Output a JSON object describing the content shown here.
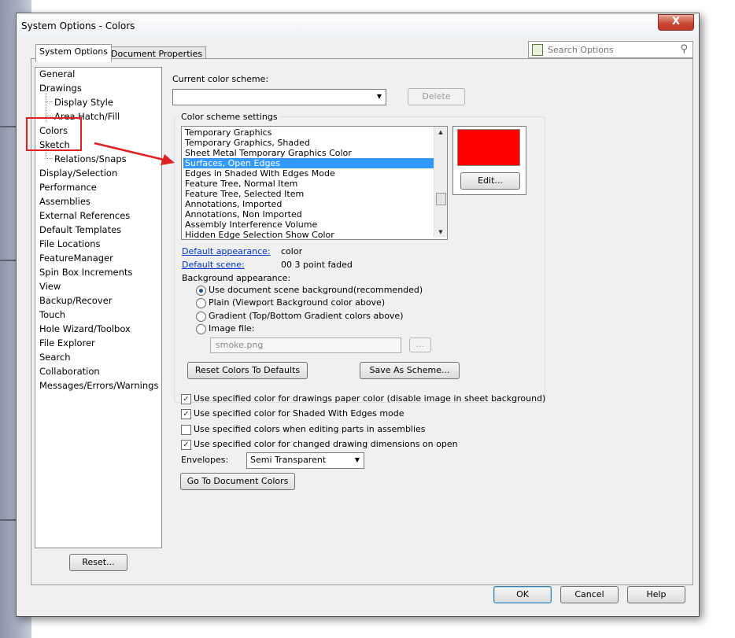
{
  "window": {
    "title": "System Options - Colors",
    "close_glyph": "X"
  },
  "tabs": [
    {
      "label": "System Options",
      "active": true
    },
    {
      "label": "Document Properties",
      "active": false
    }
  ],
  "search": {
    "placeholder": "Search Options",
    "value": ""
  },
  "tree": {
    "items": [
      {
        "label": "General",
        "level": 0
      },
      {
        "label": "Drawings",
        "level": 0
      },
      {
        "label": "Display Style",
        "level": 1
      },
      {
        "label": "Area Hatch/Fill",
        "level": 1
      },
      {
        "label": "Colors",
        "level": 0
      },
      {
        "label": "Sketch",
        "level": 0
      },
      {
        "label": "Relations/Snaps",
        "level": 1
      },
      {
        "label": "Display/Selection",
        "level": 0
      },
      {
        "label": "Performance",
        "level": 0
      },
      {
        "label": "Assemblies",
        "level": 0
      },
      {
        "label": "External References",
        "level": 0
      },
      {
        "label": "Default Templates",
        "level": 0
      },
      {
        "label": "File Locations",
        "level": 0
      },
      {
        "label": "FeatureManager",
        "level": 0
      },
      {
        "label": "Spin Box Increments",
        "level": 0
      },
      {
        "label": "View",
        "level": 0
      },
      {
        "label": "Backup/Recover",
        "level": 0
      },
      {
        "label": "Touch",
        "level": 0
      },
      {
        "label": "Hole Wizard/Toolbox",
        "level": 0
      },
      {
        "label": "File Explorer",
        "level": 0
      },
      {
        "label": "Search",
        "level": 0
      },
      {
        "label": "Collaboration",
        "level": 0
      },
      {
        "label": "Messages/Errors/Warnings",
        "level": 0
      }
    ],
    "reset_label": "Reset..."
  },
  "scheme": {
    "label": "Current color scheme:",
    "value": "",
    "delete_label": "Delete"
  },
  "settings": {
    "title": "Color scheme settings",
    "items": [
      "Temporary Graphics",
      "Temporary Graphics, Shaded",
      "Sheet Metal Temporary Graphics Color",
      "Surfaces, Open Edges",
      "Edges in Shaded With Edges Mode",
      "Feature Tree, Normal Item",
      "Feature Tree, Selected Item",
      "Annotations, Imported",
      "Annotations, Non Imported",
      "Assembly Interference Volume",
      "Hidden Edge Selection Show Color"
    ],
    "selected_index": 3,
    "swatch_color": "#ff0000",
    "edit_label": "Edit..."
  },
  "appearance": {
    "default_appearance_label": "Default appearance:",
    "default_appearance_value": "color",
    "default_scene_label": "Default scene:",
    "default_scene_value": "00 3 point faded",
    "background_label": "Background appearance:",
    "options": [
      {
        "label": "Use document scene background(recommended)",
        "selected": true
      },
      {
        "label": "Plain (Viewport Background color above)",
        "selected": false
      },
      {
        "label": "Gradient (Top/Bottom Gradient colors above)",
        "selected": false
      },
      {
        "label": "Image file:",
        "selected": false
      }
    ],
    "image_file": "smoke.png",
    "browse_label": "...",
    "reset_colors_label": "Reset Colors To Defaults",
    "save_scheme_label": "Save As Scheme..."
  },
  "checks": [
    {
      "label": "Use specified color for drawings paper color (disable image in sheet background)",
      "checked": true
    },
    {
      "label": "Use specified color for Shaded With Edges mode",
      "checked": true
    },
    {
      "label": "Use specified colors when editing parts in assemblies",
      "checked": false
    },
    {
      "label": "Use specified color for changed drawing dimensions on open",
      "checked": true
    }
  ],
  "envelopes": {
    "label": "Envelopes:",
    "value": "Semi Transparent"
  },
  "doc_colors_label": "Go To Document Colors",
  "footer": {
    "ok_label": "OK",
    "cancel_label": "Cancel",
    "help_label": "Help"
  },
  "colors": {
    "selection_blue": "#3399ff",
    "annotation_red": "#e02020"
  },
  "icons": [
    "search-icon",
    "document-icon",
    "close-icon",
    "chevron-down-icon"
  ]
}
